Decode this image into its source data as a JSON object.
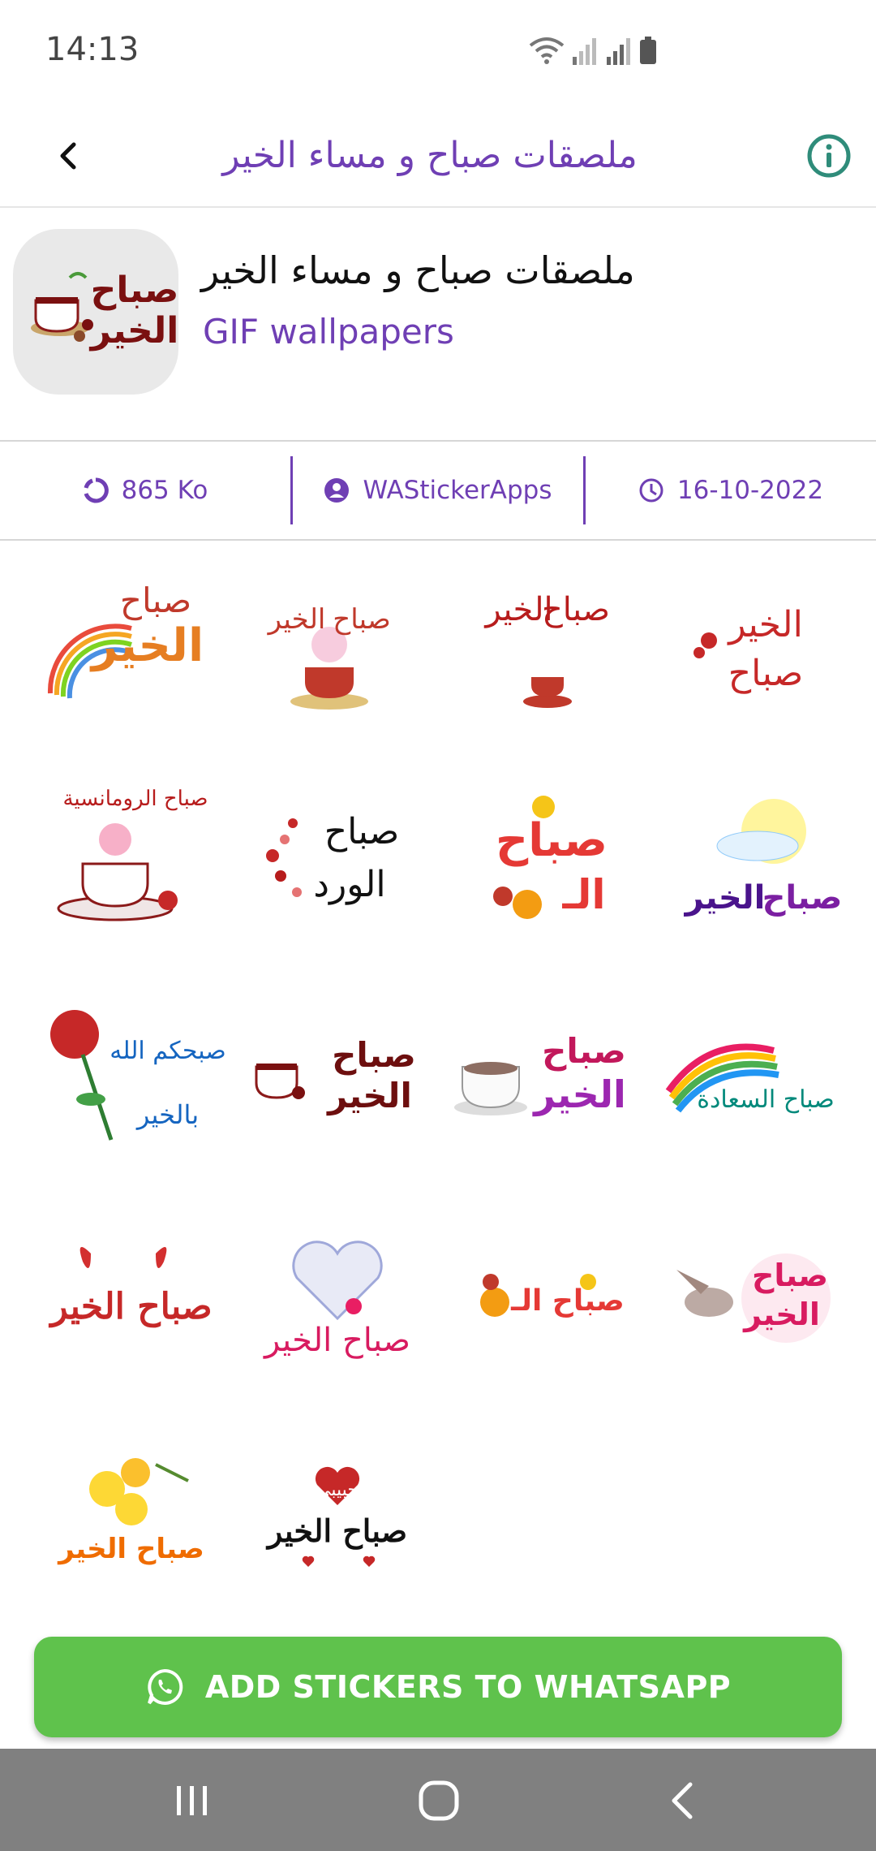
{
  "status_bar": {
    "time": "14:13"
  },
  "app_bar": {
    "title": "ملصقات صباح و مساء الخير"
  },
  "pack": {
    "name": "ملصقات صباح و مساء الخير",
    "publisher": "GIF wallpapers",
    "icon_text": [
      "صباح",
      "الخير"
    ]
  },
  "info": {
    "size": "865 Ko",
    "author": "WAStickerApps",
    "date": "16-10-2022"
  },
  "stickers": [
    {
      "line1": "صباح",
      "line2": "الخير"
    },
    {
      "line1": "صباح",
      "line2": "الخير"
    },
    {
      "line1": "صباح",
      "line2": "الخير"
    },
    {
      "line1": "صباح",
      "line2": "الخير"
    },
    {
      "line1": "صباح الرومانسية",
      "line2": ""
    },
    {
      "line1": "صباح",
      "line2": "الورد"
    },
    {
      "line1": "صباح",
      "line2": "الـ"
    },
    {
      "line1": "صباح",
      "line2": "الخير"
    },
    {
      "line1": "صبحكم الله",
      "line2": "بالخير"
    },
    {
      "line1": "صباح",
      "line2": "الخير"
    },
    {
      "line1": "صباح",
      "line2": "الخير"
    },
    {
      "line1": "صباح السعادة",
      "line2": ""
    },
    {
      "line1": "صباح الخير",
      "line2": ""
    },
    {
      "line1": "صباح الخير",
      "line2": ""
    },
    {
      "line1": "صباح الـ",
      "line2": ""
    },
    {
      "line1": "صباح",
      "line2": "الخير"
    },
    {
      "line1": "صباح الخير",
      "line2": ""
    },
    {
      "line1": "حبيبي",
      "line2": "صباح الخير"
    }
  ],
  "add_button": {
    "label": "ADD STICKERS TO WHATSAPP"
  },
  "colors": {
    "accent": "#6f3fb4",
    "button": "#5fc24c",
    "nav": "#808080"
  }
}
